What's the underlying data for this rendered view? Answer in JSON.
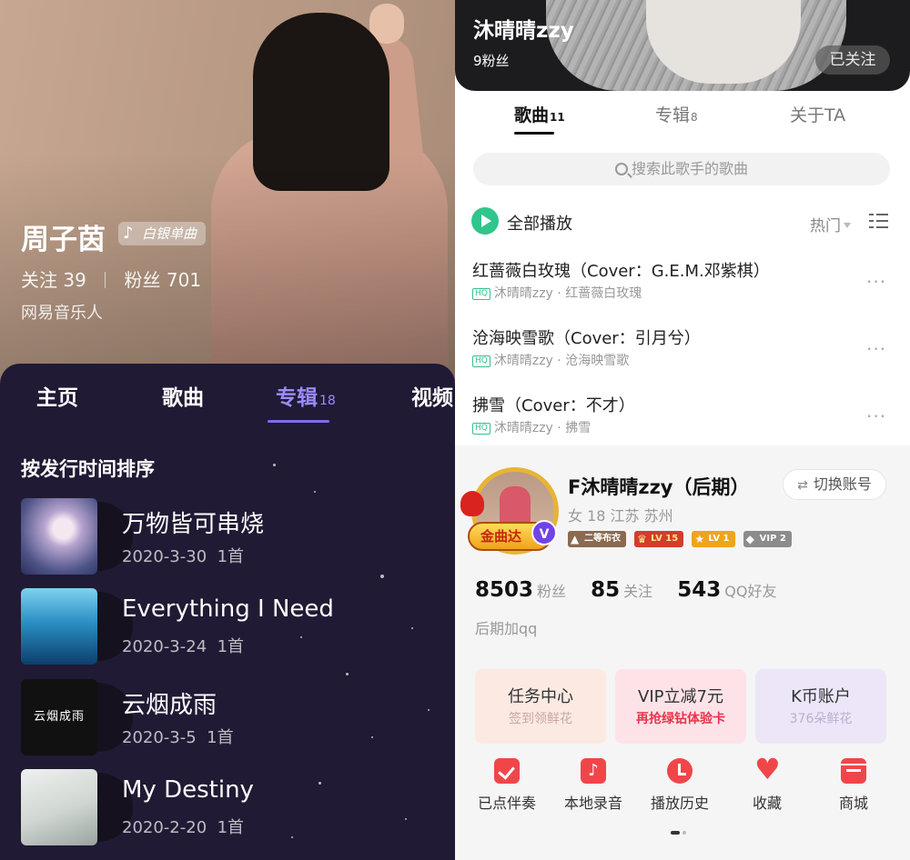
{
  "left": {
    "artist": {
      "name": "周子茵",
      "badge": "白银单曲",
      "follow_label": "关注",
      "follow_count": "39",
      "fans_label": "粉丝",
      "fans_count": "701",
      "role": "网易音乐人"
    },
    "tabs": [
      {
        "label": "主页",
        "count": ""
      },
      {
        "label": "歌曲",
        "count": ""
      },
      {
        "label": "专辑",
        "count": "18"
      },
      {
        "label": "视频",
        "count": ""
      }
    ],
    "active_tab": "专辑",
    "sort_label": "按发行时间排序",
    "albums": [
      {
        "title": "万物皆可串烧",
        "date": "2020-3-30",
        "tracks": "1首"
      },
      {
        "title": "Everything I Need",
        "date": "2020-3-24",
        "tracks": "1首"
      },
      {
        "title": "云烟成雨",
        "date": "2020-3-5",
        "tracks": "1首",
        "cover_text": "云烟成雨"
      },
      {
        "title": "My Destiny",
        "date": "2020-2-20",
        "tracks": "1首"
      }
    ]
  },
  "right_top": {
    "singer": "沐晴晴zzy",
    "fans": "9粉丝",
    "followed_label": "已关注",
    "tabs": [
      {
        "label": "歌曲",
        "count": "11"
      },
      {
        "label": "专辑",
        "count": "8"
      },
      {
        "label": "关于TA",
        "count": ""
      }
    ],
    "search_placeholder": "搜索此歌手的歌曲",
    "play_all": "全部播放",
    "sort": "热门",
    "hq_label": "HQ",
    "songs": [
      {
        "title": "红蔷薇白玫瑰（Cover：G.E.M.邓紫棋）",
        "artist": "沐晴晴zzy",
        "album": "红蔷薇白玫瑰"
      },
      {
        "title": "沧海映雪歌（Cover：引月兮）",
        "artist": "沐晴晴zzy",
        "album": "沧海映雪歌"
      },
      {
        "title": "拂雪（Cover：不才）",
        "artist": "沐晴晴zzy",
        "album": "拂雪"
      }
    ],
    "more_glyph": "···"
  },
  "right_bottom": {
    "username": "F沐晴晴zzy（后期）",
    "switch_label": "切换账号",
    "location": "女 18   江苏 苏州",
    "avatar_badge": "金曲达",
    "badges": [
      "二等布衣",
      "LV 15",
      "LV 1",
      "VIP 2"
    ],
    "stats": [
      {
        "num": "8503",
        "label": "粉丝"
      },
      {
        "num": "85",
        "label": "关注"
      },
      {
        "num": "543",
        "label": "QQ好友"
      }
    ],
    "signature": "后期加qq",
    "cards": [
      {
        "title": "任务中心",
        "sub": "签到领鲜花"
      },
      {
        "title": "VIP立减7元",
        "sub": "再抢绿钻体验卡"
      },
      {
        "title": "K币账户",
        "sub": "376朵鲜花"
      }
    ],
    "shortcuts": [
      {
        "label": "已点伴奏",
        "icon": "check-list-icon"
      },
      {
        "label": "本地录音",
        "icon": "music-note-icon"
      },
      {
        "label": "播放历史",
        "icon": "clock-icon"
      },
      {
        "label": "收藏",
        "icon": "heart-icon"
      },
      {
        "label": "商城",
        "icon": "store-icon"
      }
    ]
  },
  "colors": {
    "left_accent": "#9a8cff",
    "play_green": "#2fc58c",
    "shortcut_red": "#f0464a",
    "gold": "#e7b436"
  }
}
